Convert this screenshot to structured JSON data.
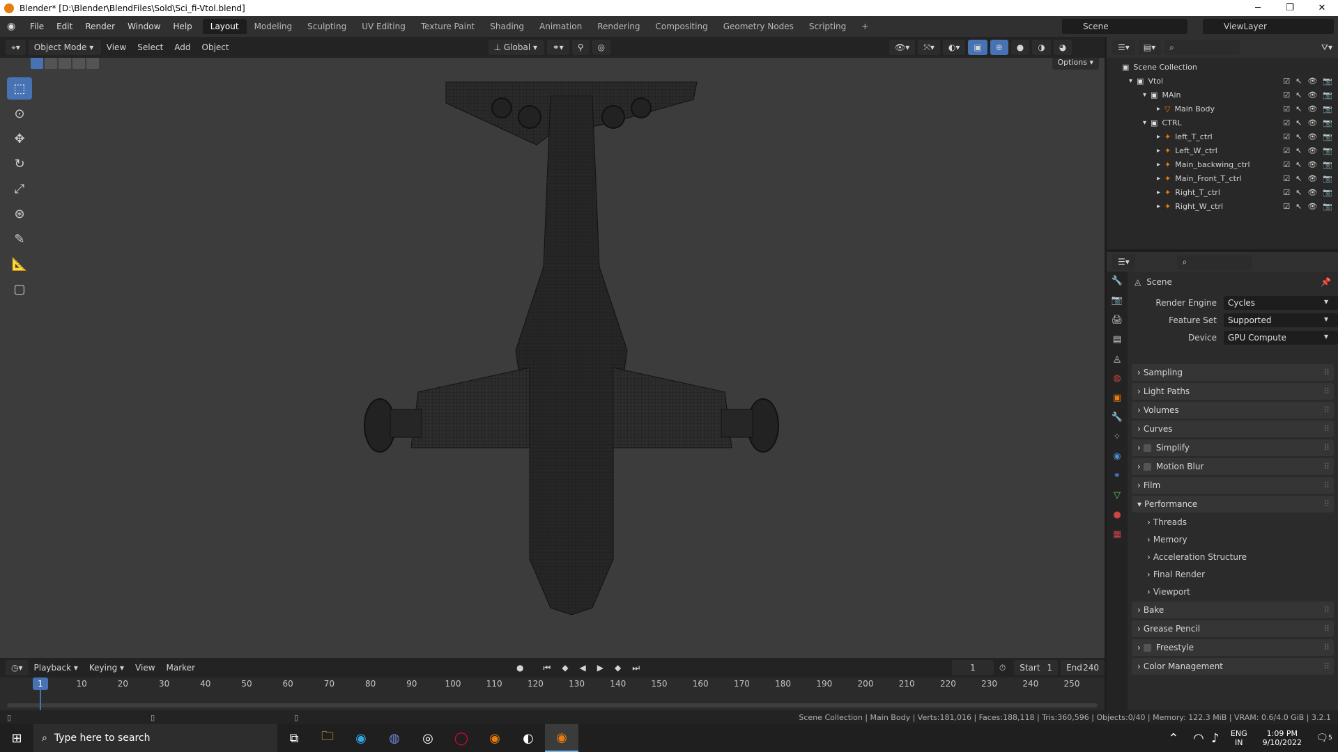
{
  "window": {
    "title": "Blender* [D:\\Blender\\BlendFiles\\Sold\\Sci_fi-Vtol.blend]",
    "minimize": "─",
    "maximize": "❐",
    "close": "✕"
  },
  "menus": [
    "File",
    "Edit",
    "Render",
    "Window",
    "Help"
  ],
  "workspaces": [
    "Layout",
    "Modeling",
    "Sculpting",
    "UV Editing",
    "Texture Paint",
    "Shading",
    "Animation",
    "Rendering",
    "Compositing",
    "Geometry Nodes",
    "Scripting",
    "+"
  ],
  "active_workspace": "Layout",
  "scene_name": "Scene",
  "view_layer": "ViewLayer",
  "viewport_header": {
    "mode": "Object Mode",
    "menus": [
      "View",
      "Select",
      "Add",
      "Object"
    ],
    "orientation": "Global",
    "options": "Options"
  },
  "outliner": {
    "root": "Scene Collection",
    "rows": [
      {
        "label": "Vtol",
        "indent": 0,
        "icon": "collection-icon"
      },
      {
        "label": "MAin",
        "indent": 1,
        "icon": "collection-icon"
      },
      {
        "label": "Main Body",
        "indent": 2,
        "icon": "mesh-icon"
      },
      {
        "label": "CTRL",
        "indent": 1,
        "icon": "collection-icon"
      },
      {
        "label": "left_T_ctrl",
        "indent": 2,
        "icon": "armature-icon"
      },
      {
        "label": "Left_W_ctrl",
        "indent": 2,
        "icon": "armature-icon"
      },
      {
        "label": "Main_backwing_ctrl",
        "indent": 2,
        "icon": "armature-icon"
      },
      {
        "label": "Main_Front_T_ctrl",
        "indent": 2,
        "icon": "armature-icon"
      },
      {
        "label": "Right_T_ctrl",
        "indent": 2,
        "icon": "armature-icon"
      },
      {
        "label": "Right_W_ctrl",
        "indent": 2,
        "icon": "armature-icon"
      }
    ]
  },
  "properties": {
    "title": "Scene",
    "fields": [
      {
        "label": "Render Engine",
        "value": "Cycles"
      },
      {
        "label": "Feature Set",
        "value": "Supported"
      },
      {
        "label": "Device",
        "value": "GPU Compute"
      }
    ],
    "panels": [
      {
        "label": "Sampling",
        "type": "panel",
        "checkbox": false
      },
      {
        "label": "Light Paths",
        "type": "panel",
        "checkbox": false
      },
      {
        "label": "Volumes",
        "type": "panel",
        "checkbox": false
      },
      {
        "label": "Curves",
        "type": "panel",
        "checkbox": false
      },
      {
        "label": "Simplify",
        "type": "panel",
        "checkbox": true
      },
      {
        "label": "Motion Blur",
        "type": "panel",
        "checkbox": true
      },
      {
        "label": "Film",
        "type": "panel",
        "checkbox": false
      },
      {
        "label": "Performance",
        "type": "panel-open",
        "checkbox": false
      },
      {
        "label": "Threads",
        "type": "sub",
        "checkbox": false
      },
      {
        "label": "Memory",
        "type": "sub",
        "checkbox": false
      },
      {
        "label": "Acceleration Structure",
        "type": "sub",
        "checkbox": false
      },
      {
        "label": "Final Render",
        "type": "sub",
        "checkbox": false
      },
      {
        "label": "Viewport",
        "type": "sub",
        "checkbox": false
      },
      {
        "label": "Bake",
        "type": "panel",
        "checkbox": false
      },
      {
        "label": "Grease Pencil",
        "type": "panel",
        "checkbox": false
      },
      {
        "label": "Freestyle",
        "type": "panel",
        "checkbox": true
      },
      {
        "label": "Color Management",
        "type": "panel",
        "checkbox": false
      }
    ]
  },
  "timeline": {
    "menus": [
      "Playback",
      "Keying",
      "View",
      "Marker"
    ],
    "current_frame": "1",
    "start_label": "Start",
    "start": "1",
    "end_label": "End",
    "end": "240",
    "ticks": [
      "1",
      "10",
      "20",
      "30",
      "40",
      "50",
      "60",
      "70",
      "80",
      "90",
      "100",
      "110",
      "120",
      "130",
      "140",
      "150",
      "160",
      "170",
      "180",
      "190",
      "200",
      "210",
      "220",
      "230",
      "240",
      "250"
    ]
  },
  "status": "Scene Collection | Main Body | Verts:181,016 | Faces:188,118 | Tris:360,596 | Objects:0/40 | Memory: 122.3 MiB | VRAM: 0.6/4.0 GiB | 3.2.1",
  "taskbar": {
    "search_placeholder": "Type here to search",
    "lang1": "ENG",
    "lang2": "IN",
    "time": "1:09 PM",
    "date": "9/10/2022",
    "notif_count": "5"
  },
  "colors": {
    "accent": "#4772b3",
    "brand_orange": "#e87d0d"
  }
}
